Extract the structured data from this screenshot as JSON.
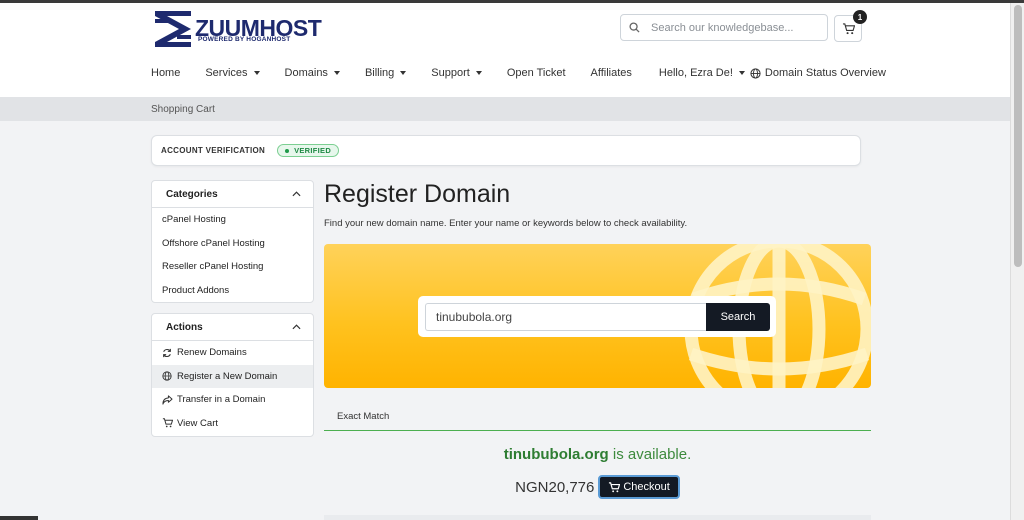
{
  "brand": {
    "name": "ZUUMHOST",
    "tagline": "POWERED BY HOGANHOST",
    "color": "#1e2a6e"
  },
  "header": {
    "search_placeholder": "Search our knowledgebase...",
    "cart_count": "1"
  },
  "nav": {
    "items": [
      {
        "label": "Home",
        "dropdown": false
      },
      {
        "label": "Services",
        "dropdown": true
      },
      {
        "label": "Domains",
        "dropdown": true
      },
      {
        "label": "Billing",
        "dropdown": true
      },
      {
        "label": "Support",
        "dropdown": true
      },
      {
        "label": "Open Ticket",
        "dropdown": false
      },
      {
        "label": "Affiliates",
        "dropdown": false
      },
      {
        "label": "Hello, Ezra De!",
        "dropdown": true
      },
      {
        "label": "Domain Status Overview",
        "dropdown": false,
        "icon": "globe-icon"
      }
    ]
  },
  "breadcrumb": "Shopping Cart",
  "verification": {
    "label": "ACCOUNT VERIFICATION",
    "status": "VERIFIED"
  },
  "sidebar": {
    "categories": {
      "title": "Categories",
      "items": [
        "cPanel Hosting",
        "Offshore cPanel Hosting",
        "Reseller cPanel Hosting",
        "Product Addons"
      ]
    },
    "actions": {
      "title": "Actions",
      "items": [
        {
          "label": "Renew Domains",
          "icon": "refresh-icon"
        },
        {
          "label": "Register a New Domain",
          "icon": "globe-icon",
          "active": true
        },
        {
          "label": "Transfer in a Domain",
          "icon": "share-arrow-icon"
        },
        {
          "label": "View Cart",
          "icon": "cart-icon"
        }
      ]
    }
  },
  "main": {
    "title": "Register Domain",
    "subtitle": "Find your new domain name. Enter your name or keywords below to check availability.",
    "search_value": "tinububola.org",
    "search_button": "Search",
    "tab": "Exact Match",
    "result": {
      "domain": "tinububola.org",
      "message": " is available.",
      "price": "NGN20,776",
      "checkout_label": "Checkout"
    }
  },
  "colors": {
    "hero_yellow": "#ffc21f",
    "dark_button": "#141a24",
    "available_green": "#2e7d32"
  }
}
